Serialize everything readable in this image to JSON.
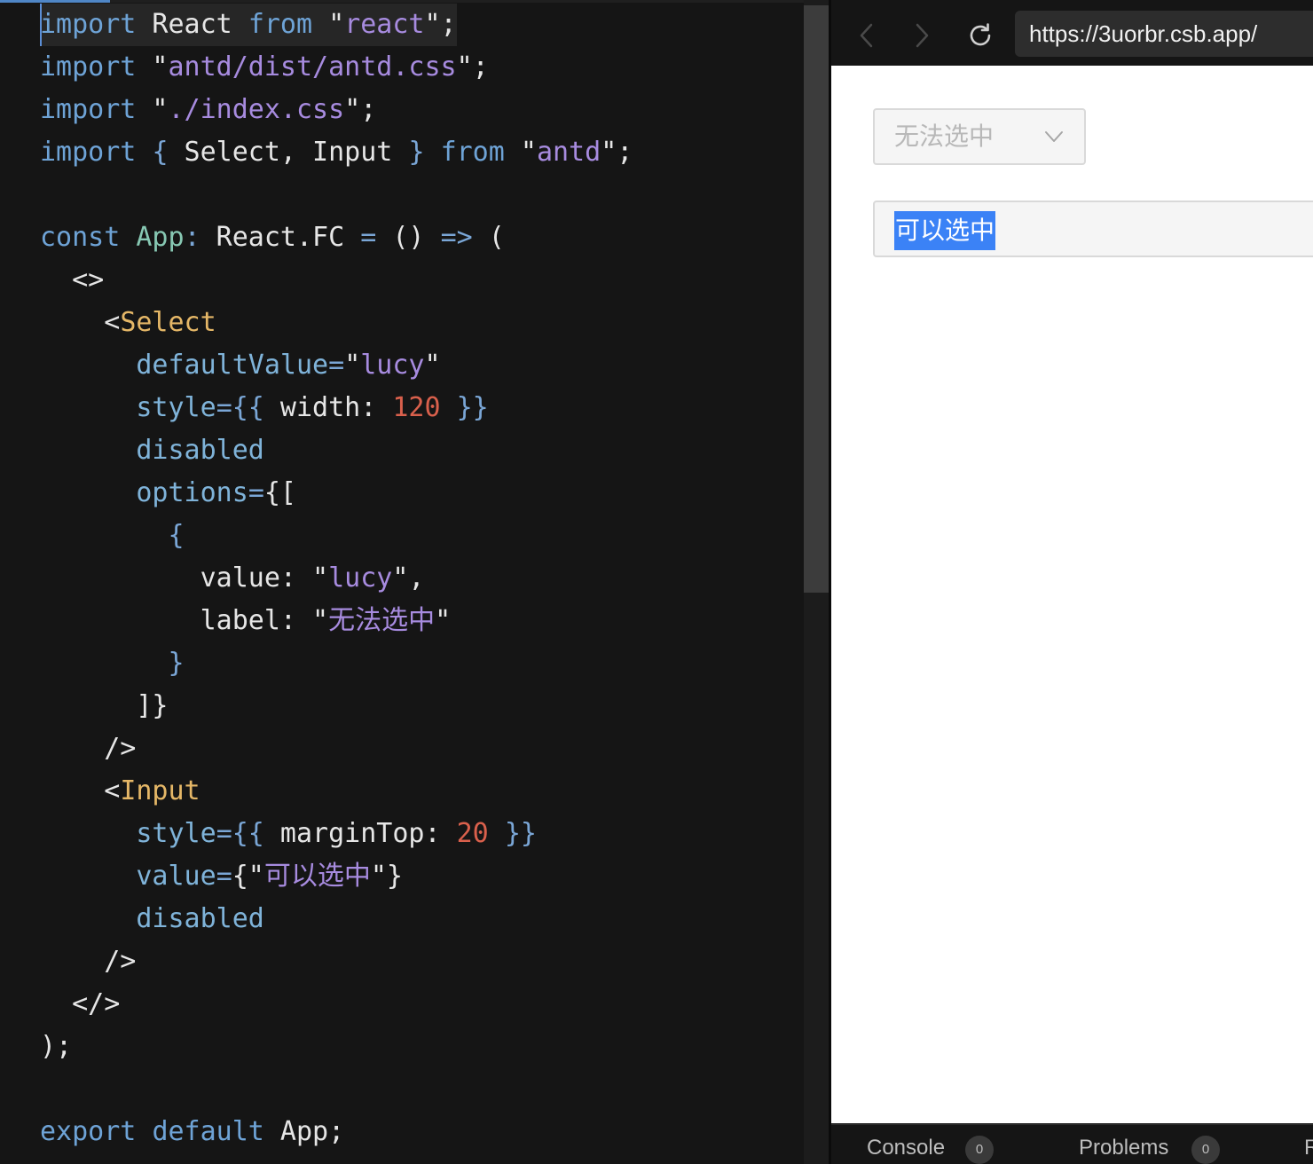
{
  "editor": {
    "code": {
      "l1": [
        "import",
        " React ",
        "from",
        " \"",
        "react",
        "\";"
      ],
      "l2": [
        "import",
        " \"",
        "antd/dist/antd.css",
        "\";"
      ],
      "l3": [
        "import",
        " \"",
        "./index.css",
        "\";"
      ],
      "l4": [
        "import",
        " ",
        "{",
        " Select, Input ",
        "}",
        " ",
        "from",
        " \"",
        "antd",
        "\";"
      ],
      "l6": [
        "const",
        " ",
        "App",
        ":",
        " React.FC ",
        "=",
        " () ",
        "=>",
        " ("
      ],
      "l7": [
        "  <>"
      ],
      "l8": [
        "    <",
        "Select"
      ],
      "l9": [
        "      ",
        "defaultValue",
        "=",
        "\"",
        "lucy",
        "\""
      ],
      "l10": [
        "      ",
        "style",
        "=",
        "{{",
        " width: ",
        "120",
        " ",
        "}}"
      ],
      "l11": [
        "      ",
        "disabled"
      ],
      "l12": [
        "      ",
        "options",
        "=",
        "{["
      ],
      "l13": [
        "        ",
        "{"
      ],
      "l14": [
        "          value: \"",
        "lucy",
        "\","
      ],
      "l15": [
        "          label: \"",
        "无法选中",
        "\""
      ],
      "l16": [
        "        ",
        "}"
      ],
      "l17": [
        "      ]}"
      ],
      "l18": [
        "    />"
      ],
      "l19": [
        "    <",
        "Input"
      ],
      "l20": [
        "      ",
        "style",
        "=",
        "{{",
        " marginTop: ",
        "20",
        " ",
        "}}"
      ],
      "l21": [
        "      ",
        "value",
        "=",
        "{\"",
        "可以选中",
        "\"}"
      ],
      "l22": [
        "      ",
        "disabled"
      ],
      "l23": [
        "    />"
      ],
      "l24": [
        "  </>"
      ],
      "l25": [
        ");"
      ],
      "l27": [
        "export",
        " ",
        "default",
        " App;"
      ]
    }
  },
  "browser": {
    "url": "https://3uorbr.csb.app/",
    "back_icon": "chevron-left-icon",
    "forward_icon": "chevron-right-icon",
    "reload_icon": "reload-icon",
    "select_value": "无法选中",
    "input_value": "可以选中",
    "bottom": {
      "console_label": "Console",
      "console_count": "0",
      "problems_label": "Problems",
      "problems_count": "0",
      "next_tab_fragment": "R"
    }
  },
  "colors": {
    "keyword": "#6ea3d6",
    "string": "#a78bdf",
    "tag": "#e5b767",
    "number": "#d9604c",
    "selection": "#3b82f6"
  }
}
